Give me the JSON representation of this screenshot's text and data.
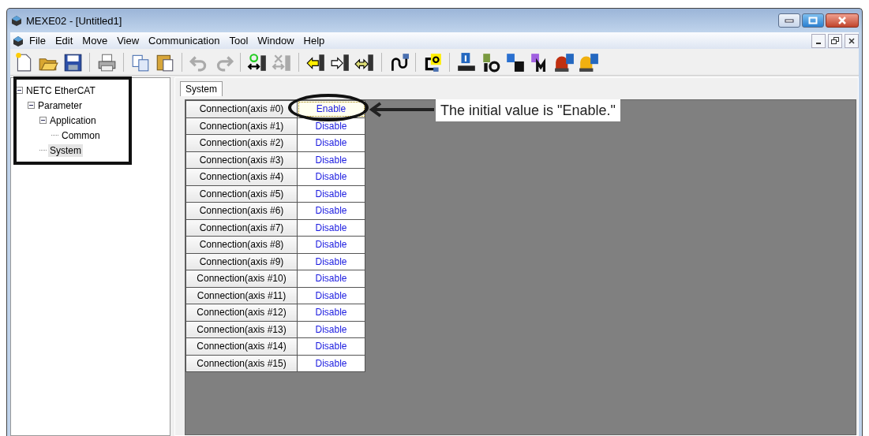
{
  "window": {
    "title": "MEXE02 - [Untitled1]"
  },
  "menu": [
    "File",
    "Edit",
    "Move",
    "View",
    "Communication",
    "Tool",
    "Window",
    "Help"
  ],
  "tree": [
    {
      "label": "NETC EtherCAT",
      "expanded": true,
      "selected": false,
      "children": [
        {
          "label": "Parameter",
          "expanded": true,
          "selected": false,
          "children": [
            {
              "label": "Application",
              "expanded": true,
              "selected": false,
              "children": [
                {
                  "label": "Common",
                  "selected": false
                }
              ]
            },
            {
              "label": "System",
              "selected": true
            }
          ]
        }
      ]
    }
  ],
  "tabs": [
    {
      "label": "System",
      "selected": true
    }
  ],
  "table": {
    "rows": [
      {
        "name": "Connection(axis #0)",
        "value": "Enable",
        "selected": true
      },
      {
        "name": "Connection(axis #1)",
        "value": "Disable",
        "selected": false
      },
      {
        "name": "Connection(axis #2)",
        "value": "Disable",
        "selected": false
      },
      {
        "name": "Connection(axis #3)",
        "value": "Disable",
        "selected": false
      },
      {
        "name": "Connection(axis #4)",
        "value": "Disable",
        "selected": false
      },
      {
        "name": "Connection(axis #5)",
        "value": "Disable",
        "selected": false
      },
      {
        "name": "Connection(axis #6)",
        "value": "Disable",
        "selected": false
      },
      {
        "name": "Connection(axis #7)",
        "value": "Disable",
        "selected": false
      },
      {
        "name": "Connection(axis #8)",
        "value": "Disable",
        "selected": false
      },
      {
        "name": "Connection(axis #9)",
        "value": "Disable",
        "selected": false
      },
      {
        "name": "Connection(axis #10)",
        "value": "Disable",
        "selected": false
      },
      {
        "name": "Connection(axis #11)",
        "value": "Disable",
        "selected": false
      },
      {
        "name": "Connection(axis #12)",
        "value": "Disable",
        "selected": false
      },
      {
        "name": "Connection(axis #13)",
        "value": "Disable",
        "selected": false
      },
      {
        "name": "Connection(axis #14)",
        "value": "Disable",
        "selected": false
      },
      {
        "name": "Connection(axis #15)",
        "value": "Disable",
        "selected": false
      }
    ]
  },
  "annotation": {
    "text": "The initial value is \"Enable.\""
  }
}
